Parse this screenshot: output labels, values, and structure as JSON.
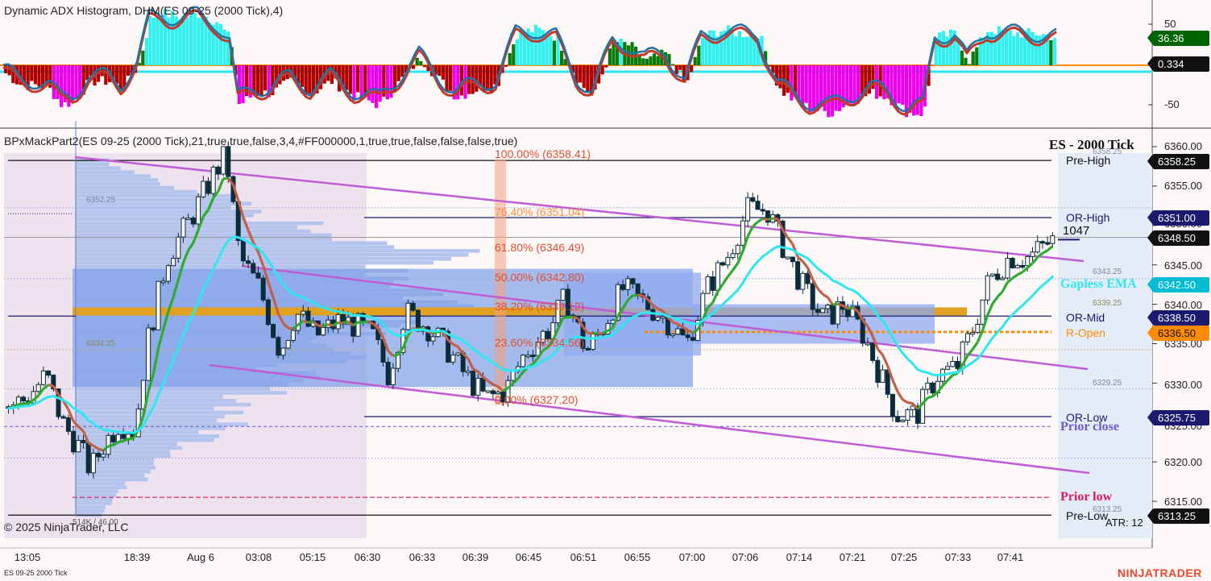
{
  "top_panel": {
    "title": "Dynamic ADX Histogram, DHM(ES 09-25 (2000 Tick),4)",
    "y_ticks": [
      "50",
      "-50"
    ],
    "tags": [
      {
        "value": "36.36",
        "color": "#006400"
      },
      {
        "value": "0.334",
        "color": "#111111"
      }
    ]
  },
  "main_panel": {
    "title": "BPxMackPart2(ES 09-25 (2000 Tick),21,true,true,false,3,4,#FF000000,1,true,true,false,false,false,true)",
    "instrument_label": "ES - 2000 Tick",
    "y_ticks": [
      "6360.00",
      "6355.00",
      "6350.00",
      "6345.00",
      "6340.00",
      "6335.00",
      "6330.00",
      "6325.00",
      "6320.00",
      "6315.00"
    ],
    "price_tags": [
      {
        "value": "6358.25",
        "color": "#111111"
      },
      {
        "value": "6351.00",
        "color": "#1a1a6e"
      },
      {
        "value": "6348.50",
        "color": "#111111"
      },
      {
        "value": "6342.50",
        "color": "#00bcd4"
      },
      {
        "value": "6338.50",
        "color": "#1a1a6e"
      },
      {
        "value": "6336.50",
        "color": "#ff8c00"
      },
      {
        "value": "6325.75",
        "color": "#1a1a6e"
      },
      {
        "value": "6313.25",
        "color": "#111111"
      }
    ],
    "level_labels": {
      "pre_high": "Pre-High",
      "or_high": "OR-High",
      "or_mid": "OR-Mid",
      "r_open": "R-Open",
      "or_low": "OR-Low",
      "prior_close": "Prior close",
      "prior_low": "Prior low",
      "pre_low": "Pre-Low",
      "gapless_ema": "Gapless EMA"
    },
    "small_levels": [
      "6358.25",
      "6352.25",
      "6343.25",
      "6339.25",
      "6334.25",
      "6329.25",
      "6313.25"
    ],
    "fib_labels": [
      "100.00% (6358.41)",
      "76.40% (6351.04)",
      "61.80% (6346.49)",
      "50.00% (6342.80)",
      "38.20% (6339.12)",
      "23.60% (6334.56)",
      "0.00% (6327.20)"
    ],
    "volume_label": "1047",
    "profile_label": "514K / 46.00",
    "atr_label": "ATR: 12",
    "copyright": "© 2025 NinjaTrader, LLC"
  },
  "x_axis": {
    "ticks": [
      "13:05",
      "18:39",
      "Aug 6",
      "03:08",
      "05:15",
      "06:30",
      "06:33",
      "06:39",
      "06:45",
      "06:51",
      "06:55",
      "07:00",
      "07:06",
      "07:14",
      "07:21",
      "07:25",
      "07:33",
      "07:41"
    ]
  },
  "footer": {
    "instrument": "ES 09-25 2000 Tick",
    "brand": "NINJATRADER"
  },
  "colors": {
    "background": "#fdf8f8",
    "up_candle": "#2e7d32",
    "down_candle": "#0b2c3a",
    "ema_cyan": "#2ee6f0",
    "channel": "#c05cd6",
    "fib": "#e05030",
    "hist_green": "#0a7a0a",
    "hist_cyan": "#30f0f0",
    "hist_red": "#b00000",
    "hist_magenta": "#ee00ee"
  }
}
